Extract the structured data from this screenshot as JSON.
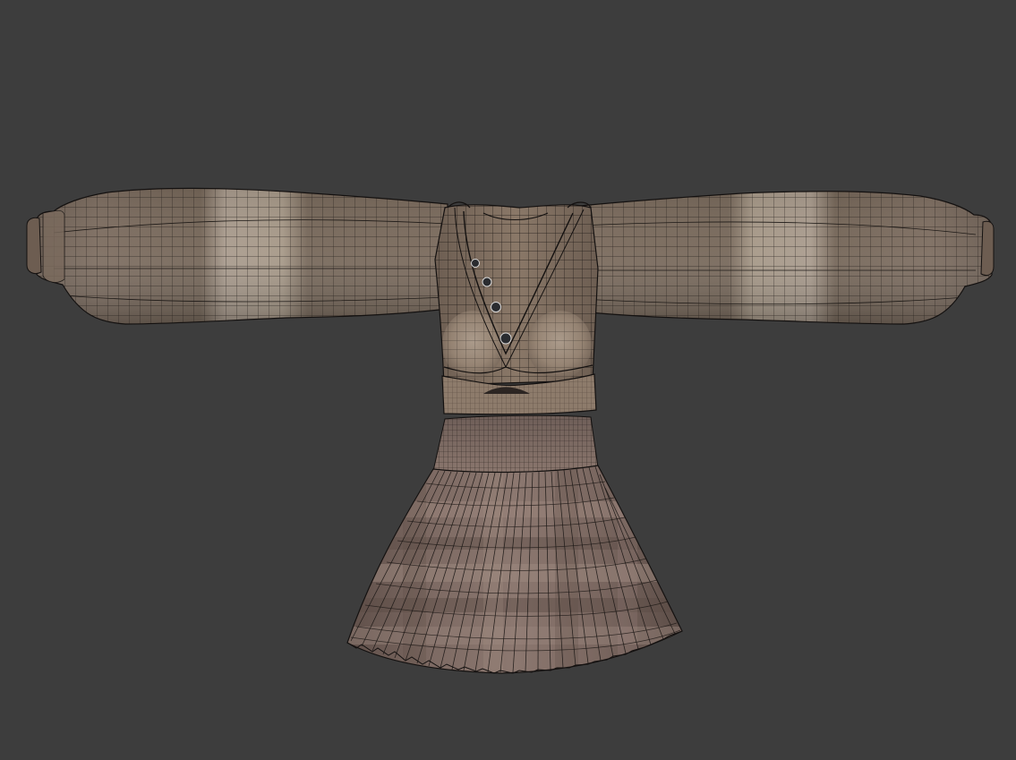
{
  "viewport": {
    "background": "#3d3d3d",
    "shading_mode": "wireframe-over-solid"
  },
  "model": {
    "name": "",
    "parts": [
      "left-sleeve",
      "right-sleeve",
      "bodice",
      "buttons",
      "waist-band",
      "skirt-waistband",
      "pleated-skirt"
    ],
    "button_count": 4,
    "colors": {
      "fabric_base": "#7b6a5a",
      "fabric_light": "#a89888",
      "fabric_dark": "#5a4d45",
      "skirt_base": "#83706a",
      "skirt_stripe": "#9a857c",
      "wire": "#1e1a17",
      "button": "#2a2c30"
    }
  }
}
